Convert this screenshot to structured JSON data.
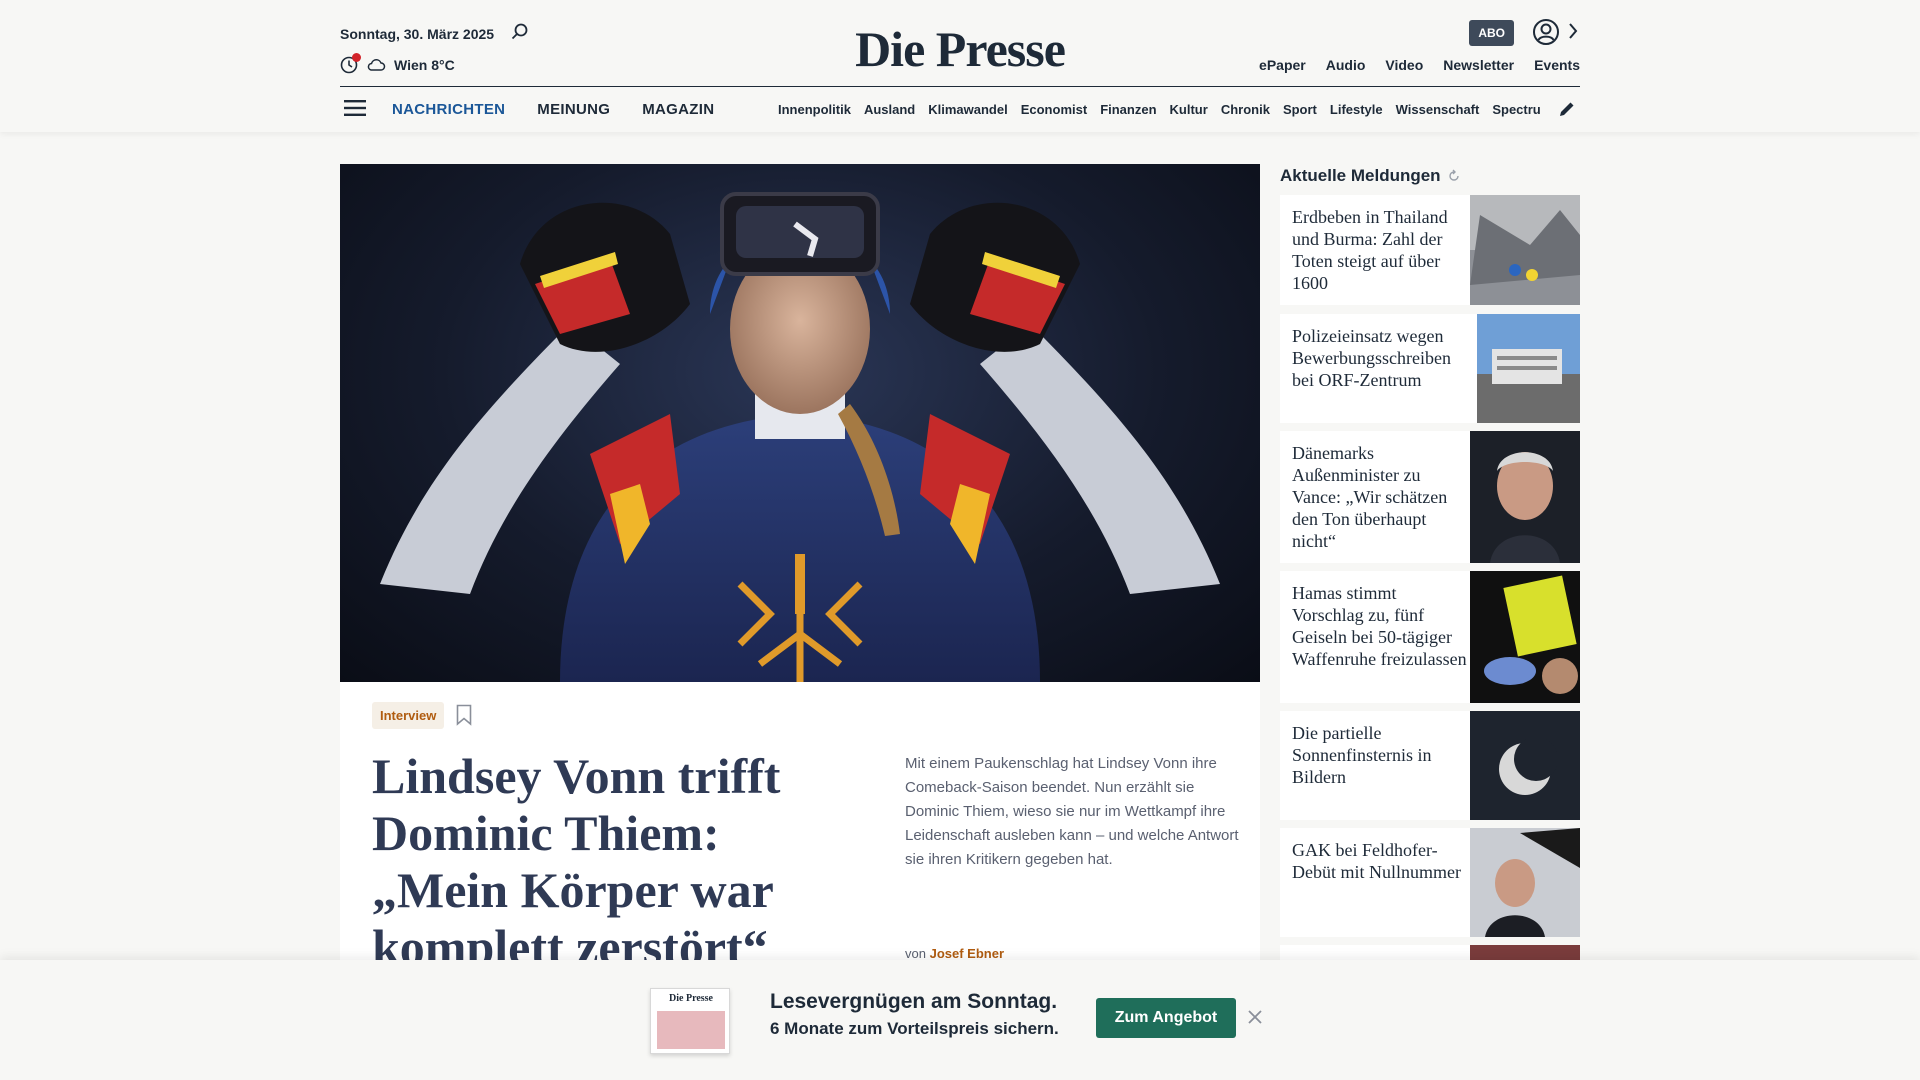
{
  "header": {
    "date": "Sonntag, 30. März 2025",
    "weather": "Wien 8°C",
    "logo": "Die Presse",
    "abo_label": "ABO",
    "quick_links": [
      "ePaper",
      "Audio",
      "Video",
      "Newsletter",
      "Events"
    ]
  },
  "nav": {
    "main": [
      {
        "label": "NACHRICHTEN",
        "active": true
      },
      {
        "label": "MEINUNG",
        "active": false
      },
      {
        "label": "MAGAZIN",
        "active": false
      }
    ],
    "sub": [
      "Innenpolitik",
      "Ausland",
      "Klimawandel",
      "Economist",
      "Finanzen",
      "Kultur",
      "Chronik",
      "Sport",
      "Lifestyle",
      "Wissenschaft",
      "Spectrum"
    ]
  },
  "hero": {
    "tag": "Interview",
    "headline": "Lindsey Vonn trifft Dominic Thiem: „Mein Körper war komplett zerstört“",
    "teaser": "Mit einem Paukenschlag hat Lindsey Vonn ihre Comeback-Saison beendet. Nun erzählt sie Dominic Thiem, wieso sie nur im Wettkampf ihre Leidenschaft ausleben kann – und welche Antwort sie ihren Kritikern gegeben hat.",
    "byline_prefix": "von",
    "author": "Josef Ebner"
  },
  "sidebar": {
    "title": "Aktuelle Meldungen",
    "items": [
      {
        "title": "Erdbeben in Thailand und Burma: Zahl der Toten steigt auf über 1600"
      },
      {
        "title": "Polizeieinsatz wegen Bewerbungsschreiben bei ORF-Zentrum"
      },
      {
        "title": "Dänemarks Außenminister zu Vance: „Wir schätzen den Ton überhaupt nicht“"
      },
      {
        "title": "Hamas stimmt Vorschlag zu, fünf Geiseln bei 50-tägiger Waffenruhe freizulassen"
      },
      {
        "title": "Die partielle Sonnenfinsternis in Bildern"
      },
      {
        "title": "GAK bei Feldhofer-Debüt mit Nullnummer"
      }
    ]
  },
  "banner": {
    "thumb_logo": "Die Presse",
    "title": "Lesevergnügen am Sonntag.",
    "subtitle": "6 Monate zum Vorteilspreis sichern.",
    "button": "Zum Angebot"
  },
  "colors": {
    "brand_navy": "#1e2a38",
    "nav_active": "#1b5798",
    "tag_orange": "#b05c10",
    "cta_green": "#1f6e5a"
  }
}
